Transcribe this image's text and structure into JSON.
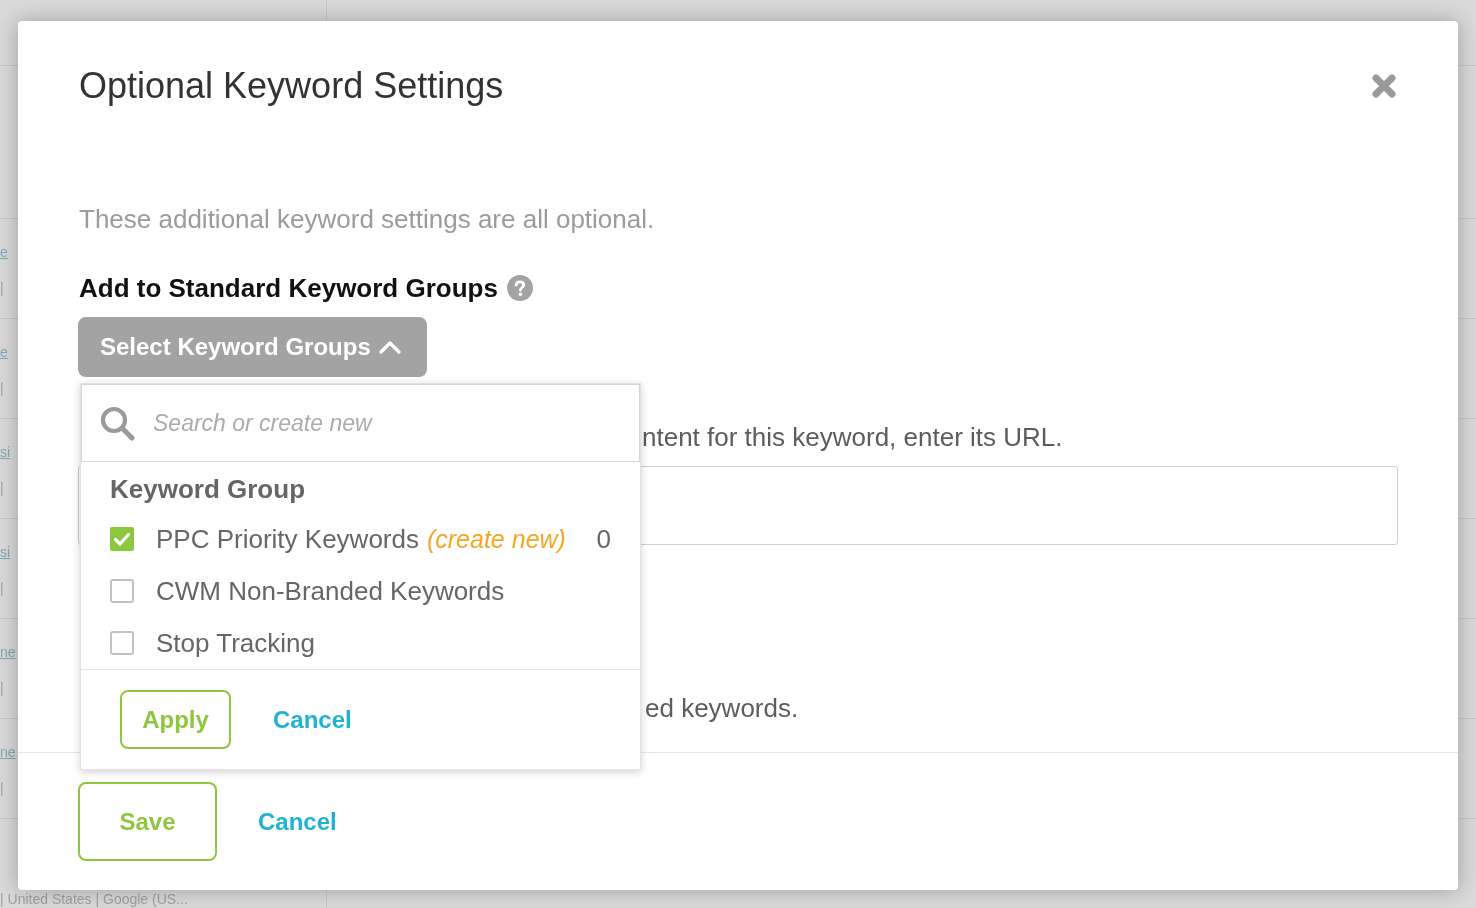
{
  "background_page": {
    "rows": [
      {
        "link": "e",
        "meta": "|"
      },
      {
        "link": "e",
        "meta": "|"
      },
      {
        "link": "si",
        "meta": "|"
      },
      {
        "link": "si",
        "meta": "|"
      },
      {
        "link": "ne",
        "meta": "|"
      },
      {
        "link": "ne",
        "meta": "|"
      }
    ],
    "last_row": {
      "meta": "| United States | Google (US..."
    }
  },
  "dialog": {
    "title": "Optional Keyword Settings",
    "description": "These additional keyword settings are all optional.",
    "keyword_groups": {
      "heading": "Add to Standard Keyword Groups",
      "dropdown_button": {
        "label": "Select Keyword Groups",
        "expanded": true
      }
    },
    "url_section": {
      "text": "ntent for this keyword, enter its URL."
    },
    "tracking_section": {
      "text": "ed keywords."
    },
    "footer": {
      "buttons": [
        {
          "label": "Save",
          "kind": "outline"
        },
        {
          "label": "Cancel",
          "kind": "link"
        }
      ]
    }
  },
  "dropdown": {
    "search": {
      "placeholder": "Search or create new"
    },
    "group_heading": "Keyword Group",
    "items": [
      {
        "label": "PPC Priority Keywords",
        "note": "(create new)",
        "count": "0",
        "checked": true
      },
      {
        "label": "CWM Non-Branded Keywords",
        "checked": false
      },
      {
        "label": "Stop Tracking",
        "checked": false
      }
    ],
    "buttons": [
      {
        "label": "Apply",
        "kind": "outline"
      },
      {
        "label": "Cancel",
        "kind": "link"
      }
    ]
  }
}
